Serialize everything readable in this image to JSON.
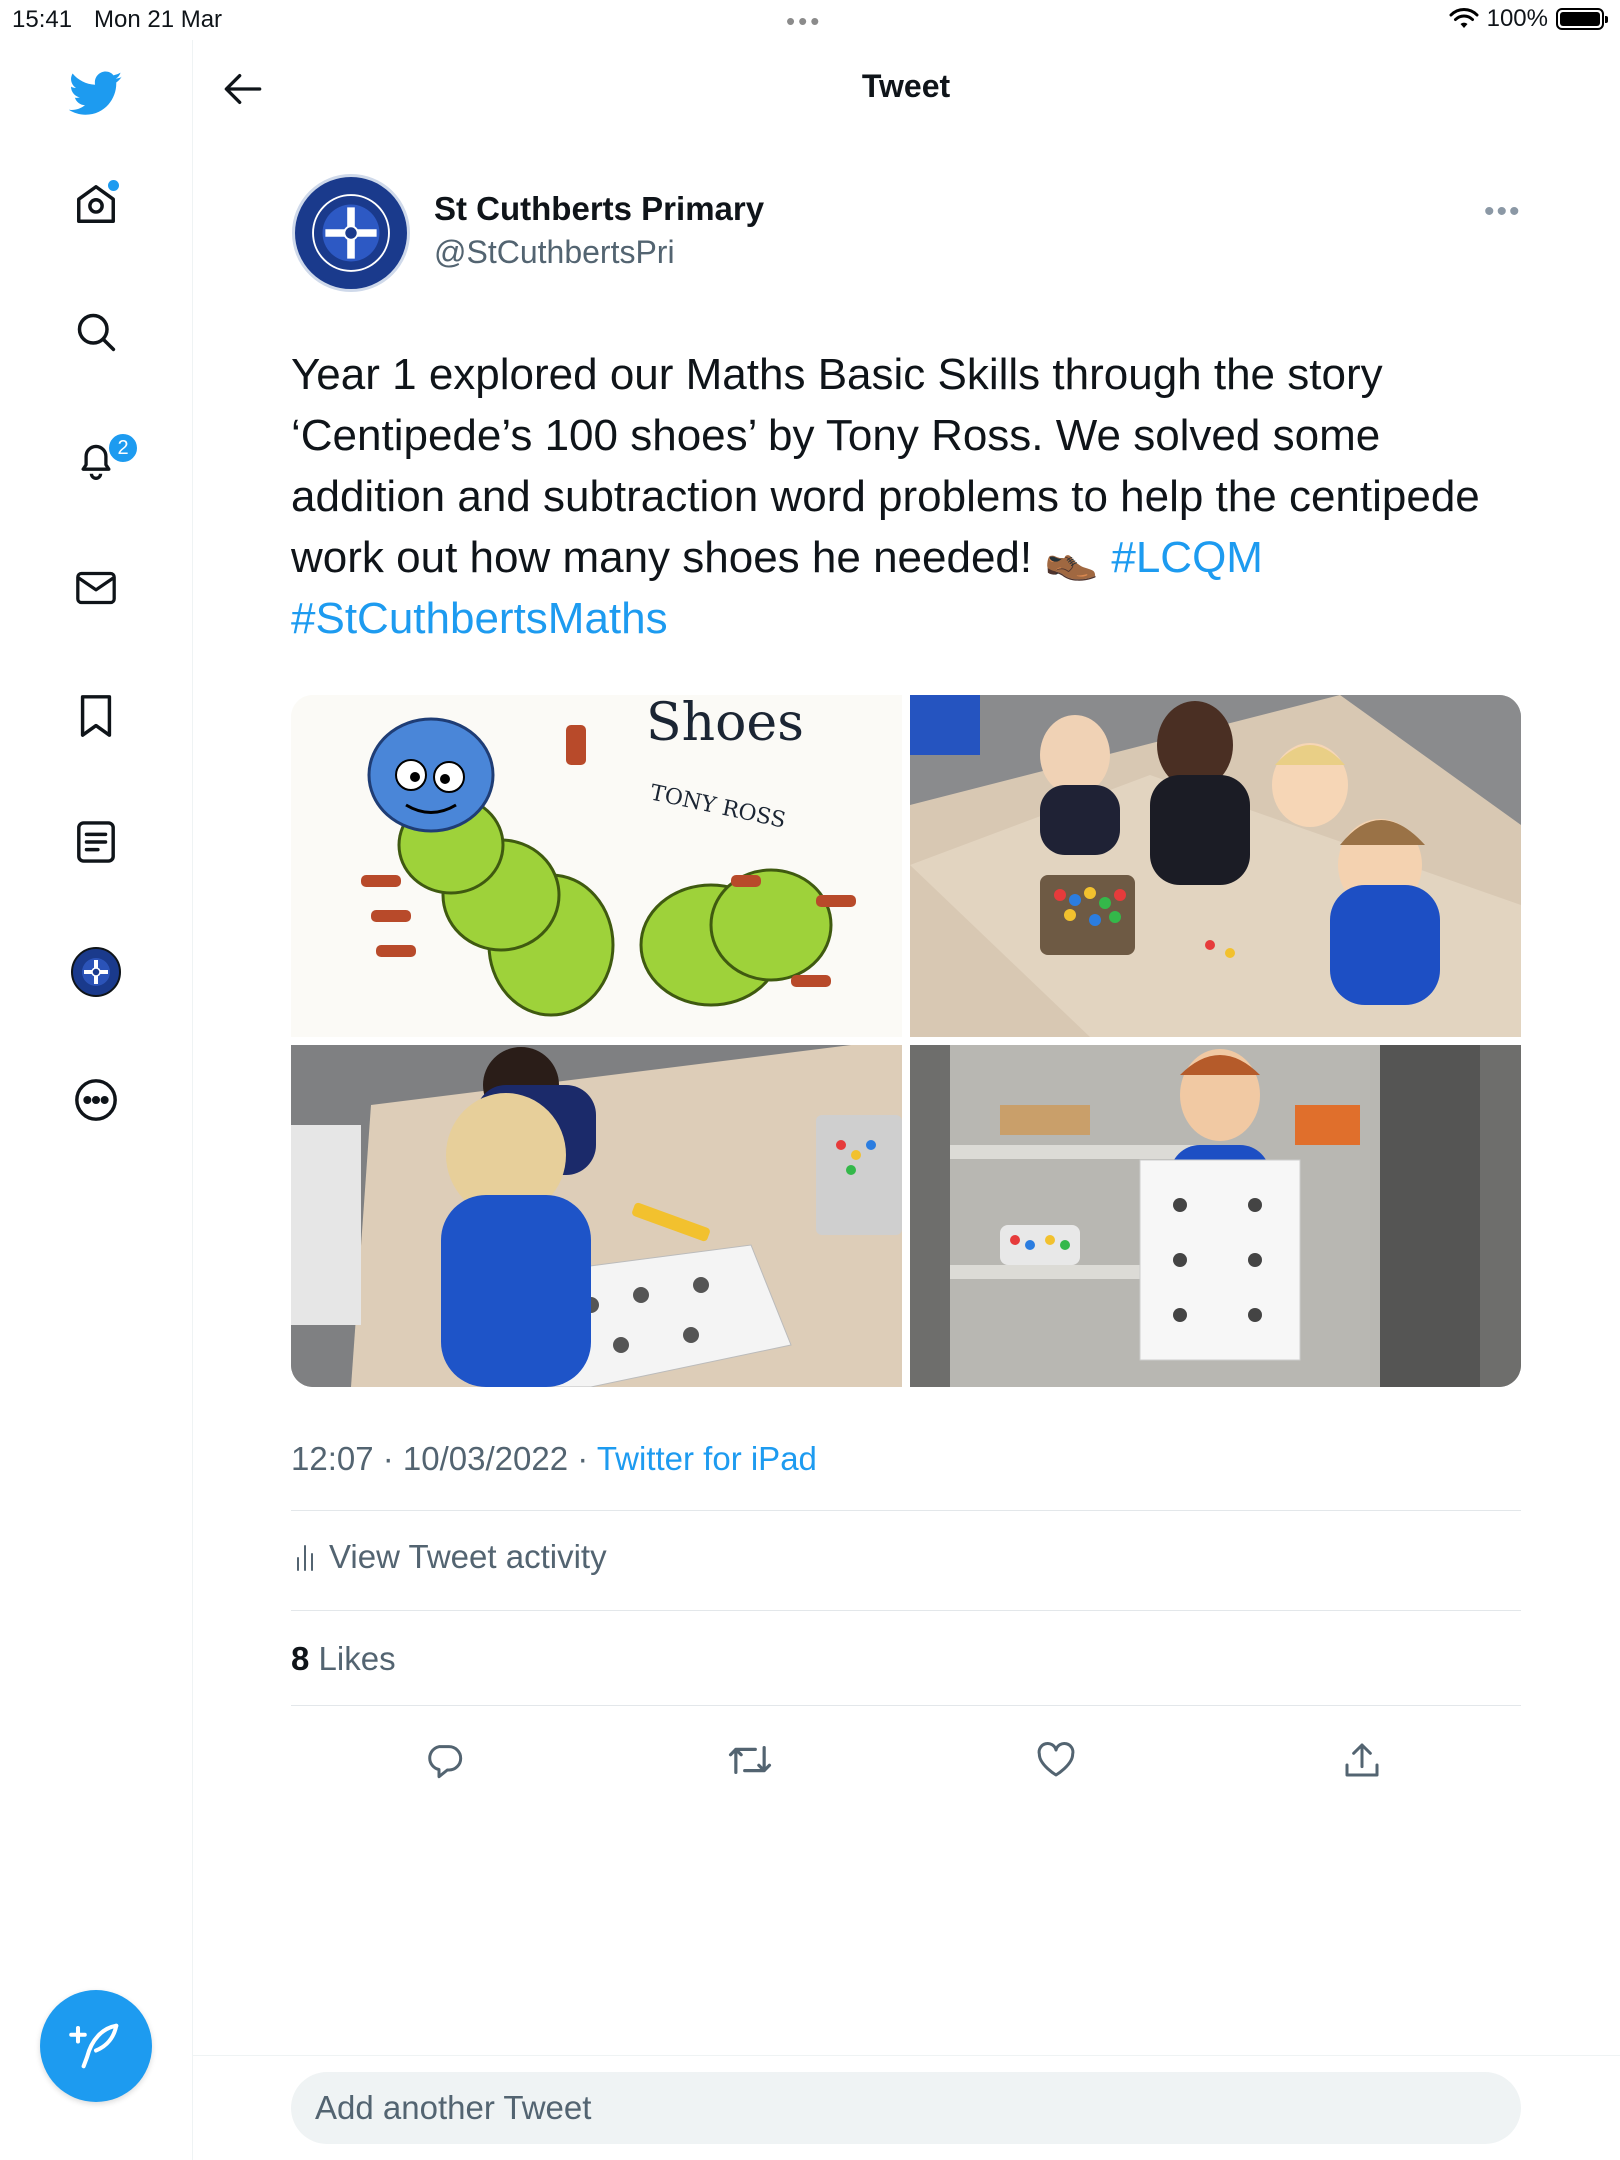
{
  "status_bar": {
    "time": "15:41",
    "date": "Mon 21 Mar",
    "battery": "100%"
  },
  "sidebar": {
    "notification_count": "2",
    "items": [
      {
        "icon": "twitter-logo-icon"
      },
      {
        "icon": "home-icon"
      },
      {
        "icon": "search-icon"
      },
      {
        "icon": "bell-icon"
      },
      {
        "icon": "mail-icon"
      },
      {
        "icon": "bookmark-icon"
      },
      {
        "icon": "list-icon"
      },
      {
        "icon": "profile-avatar-icon"
      },
      {
        "icon": "more-circle-icon"
      }
    ],
    "compose_icon": "compose-tweet-icon"
  },
  "header": {
    "title": "Tweet"
  },
  "tweet": {
    "author_name": "St Cuthberts Primary",
    "author_handle": "@StCuthbertsPri",
    "text_main": "Year 1 explored our Maths Basic Skills through the story ‘Centipede’s 100 shoes’ by Tony Ross. We solved some addition and subtraction word problems to help the centipede work out how many shoes he needed! 👞 ",
    "hashtag_1": "#LCQM",
    "hashtag_2": "#StCuthbertsMaths",
    "media": {
      "book_cover_title": "Shoes",
      "book_cover_author": "TONY ROSS"
    },
    "time": "12:07",
    "date": "10/03/2022",
    "source": "Twitter for iPad",
    "separator": " · ",
    "activity_label": "View Tweet activity",
    "likes_count": "8",
    "likes_label": "Likes"
  },
  "reply": {
    "placeholder": "Add another Tweet"
  },
  "colors": {
    "accent": "#1d9bf0",
    "text": "#0f1419",
    "secondary": "#536471"
  }
}
